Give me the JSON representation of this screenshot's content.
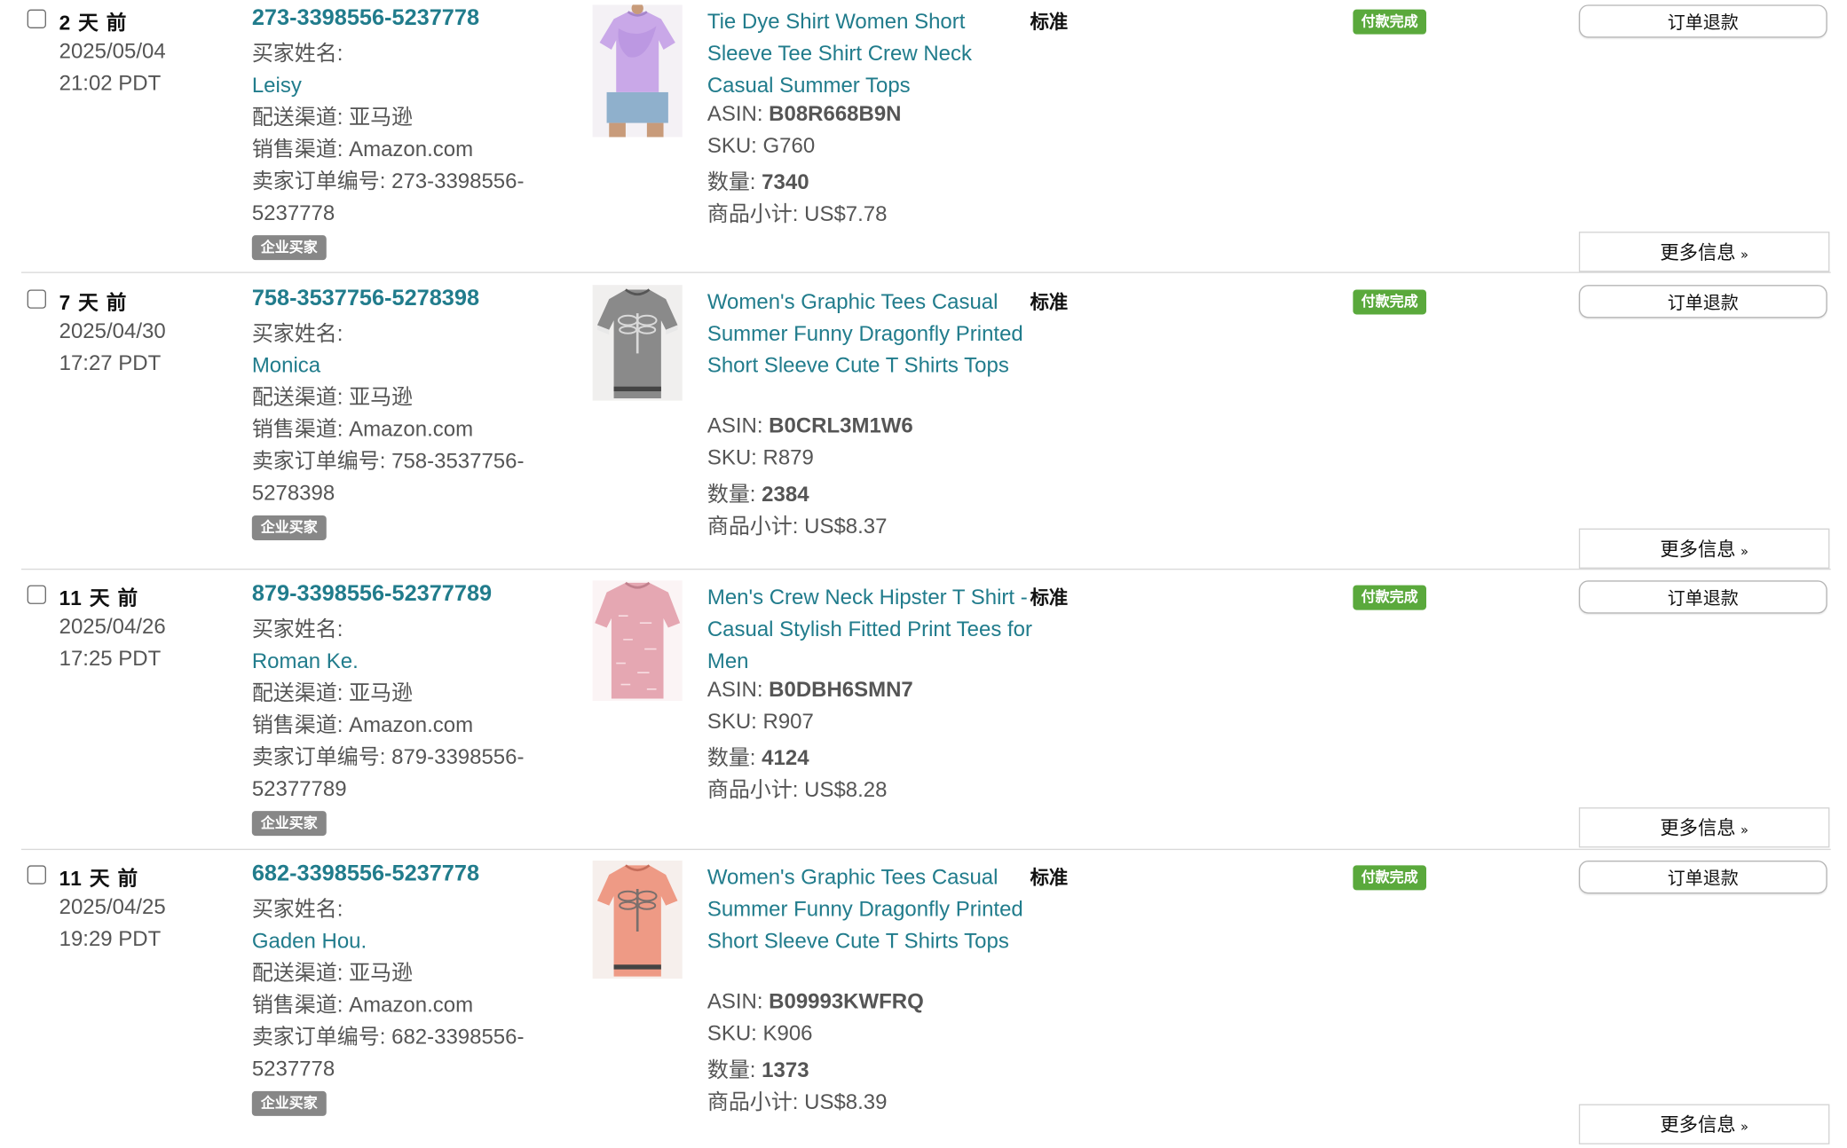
{
  "colors": {
    "link": "#217c8c",
    "paid_badge": "#5aa93c",
    "biz_badge": "#878787"
  },
  "labels": {
    "buyer_name": "买家姓名:",
    "ship_channel": "配送渠道: 亚马逊",
    "sales_channel": "销售渠道: Amazon.com",
    "seller_order": "卖家订单编号:",
    "biz_badge": "企业买家",
    "asin": "ASIN:",
    "sku": "SKU:",
    "qty": "数量:",
    "subtotal": "商品小计:",
    "standard": "标准",
    "paid": "付款完成",
    "refund_btn": "订单退款",
    "more_btn": "更多信息"
  },
  "orders": [
    {
      "ago": "2 天 前",
      "date": "2025/05/04",
      "time": "21:02 PDT",
      "order_id": "273-3398556-5237778",
      "buyer": "Leisy",
      "seller_order_a": "273-3398556-",
      "seller_order_b": "5237778",
      "title": "Tie Dye Shirt Women Short Sleeve Tee Shirt Crew Neck Casual Summer Tops",
      "asin": "B08R668B9N",
      "sku": "G760",
      "qty": "7340",
      "subtotal": "US$7.78",
      "image": "purple-tie-dye-shirt"
    },
    {
      "ago": "7 天 前",
      "date": "2025/04/30",
      "time": "17:27 PDT",
      "order_id": "758-3537756-5278398",
      "buyer": "Monica",
      "seller_order_a": "758-3537756-",
      "seller_order_b": "5278398",
      "title": "Women's Graphic Tees Casual Summer Funny Dragonfly Printed Short Sleeve Cute T Shirts Tops",
      "asin": "B0CRL3M1W6",
      "sku": "R879",
      "qty": "2384",
      "subtotal": "US$8.37",
      "image": "grey-dragonfly-tee"
    },
    {
      "ago": "11 天 前",
      "date": "2025/04/26",
      "time": "17:25 PDT",
      "order_id": "879-3398556-52377789",
      "buyer": "Roman Ke.",
      "seller_order_a": "879-3398556-",
      "seller_order_b": "52377789",
      "title": "Men's Crew Neck Hipster T Shirt - Casual Stylish Fitted Print Tees for Men",
      "asin": "B0DBH6SMN7",
      "sku": "R907",
      "qty": "4124",
      "subtotal": "US$8.28",
      "image": "pink-men-tee"
    },
    {
      "ago": "11 天 前",
      "date": "2025/04/25",
      "time": "19:29 PDT",
      "order_id": "682-3398556-5237778",
      "buyer": "Gaden Hou.",
      "seller_order_a": "682-3398556-",
      "seller_order_b": "5237778",
      "title": "Women's Graphic Tees Casual Summer Funny Dragonfly Printed Short Sleeve Cute T Shirts Tops",
      "asin": "B09993KWFRQ",
      "sku": "K906",
      "qty": "1373",
      "subtotal": "US$8.39",
      "image": "coral-dragonfly-tee"
    }
  ]
}
